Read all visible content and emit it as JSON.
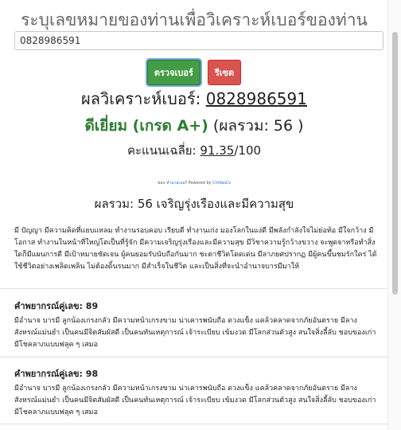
{
  "header": {
    "title": "ระบุเลขหมายของท่านเพื่อวิเคราะห์เบอร์ของท่าน"
  },
  "search": {
    "value": "0828986591"
  },
  "buttons": {
    "check": "ตรวจเบอร์",
    "reset": "รีเซต"
  },
  "result": {
    "label": "ผลวิเคราะห์เบอร์:",
    "number": "0828986591",
    "grade": "ดีเยี่ยม (เกรด A+)",
    "total": "(ผลรวม: 56 )",
    "avg_label": "คะแนนเฉลี่ย:",
    "avg_value": "91.35",
    "avg_max": "/100"
  },
  "credit": {
    "prefix": "ขอบ",
    "link": "ทำนายเบอร์",
    "powered": "Powered by",
    "brand": "ChiVasCz"
  },
  "summary": {
    "heading": "ผลรวม: 56 เจริญรุ่งเรืองและมีความสุข",
    "text": "มี ปัญญา มีความคิดที่แยบแหลม ทำงานรอบคอบ เรียบดี ทำงานเก่ง มองโลกในแง่ดี มีพลังกำลังใจไม่ย่อท้อ มีใจกว้าง มีโอกาส ทำงานในหน้าที่ใหญ่โตเป็นที่รู้จัก มีความเจริญรุ่งเรืองและมีความสุข มีวิชาความรู้กว้างขวาง จะพูดจาหรือทำสิ่งใดก็มีแผนการดี มีเป้าหมายชัดเจน ผู้คนยอมรับนับถือกันมาก ชะตาชีวิตโดดเด่น มีลาภยศปรากฏ มีผู้คนขึ้นชมรักใคร่ ได้ใช้ชีวิตอย่างเพลิดเพลิน ไม่ต้องดิ้นรนมาก มีสำเร็จในชีวิต และเป็นสิ่งที่จะนำอำนาจบารมีมาให้"
  },
  "pairs": [
    {
      "title": "คำพยากรณ์คู่เลข: 89",
      "text": "มีอำนาจ บารมี ลูกน้องเกรงกลัว มีความหน้าเกรงขาม น่าเคารพนับถือ ดวงแข็ง แคล้วคลาดจากภัยอันตราย มีลางสังหรณ์แม่นยำ เป็นคนมีจิตสัมผัสดี เป็นคนทันเหตุการณ์ เจ้าระเบียบ เข้มงวด มีโลกส่วนตัวสูง สนใจสิ่งลี้ลับ ชอบของเก่า มีโชคลาภแบบฟลุค ๆ เสมอ"
    },
    {
      "title": "คำพยากรณ์คู่เลข: 98",
      "text": "มีอำนาจ บารมี ลูกน้องเกรงกลัว มีความหน้าเกรงขาม น่าเคารพนับถือ ดวงแข็ง แคล้วคลาดจากภัยอันตราย มีลางสังหรณ์แม่นยำ เป็นคนมีจิตสัมผัสดี เป็นคนทันเหตุการณ์ เจ้าระเบียบ เข้มงวด มีโลกส่วนตัวสูง สนใจสิ่งลี้ลับ ชอบของเก่า มีโชคลาภแบบฟลุค ๆ เสมอ"
    }
  ]
}
